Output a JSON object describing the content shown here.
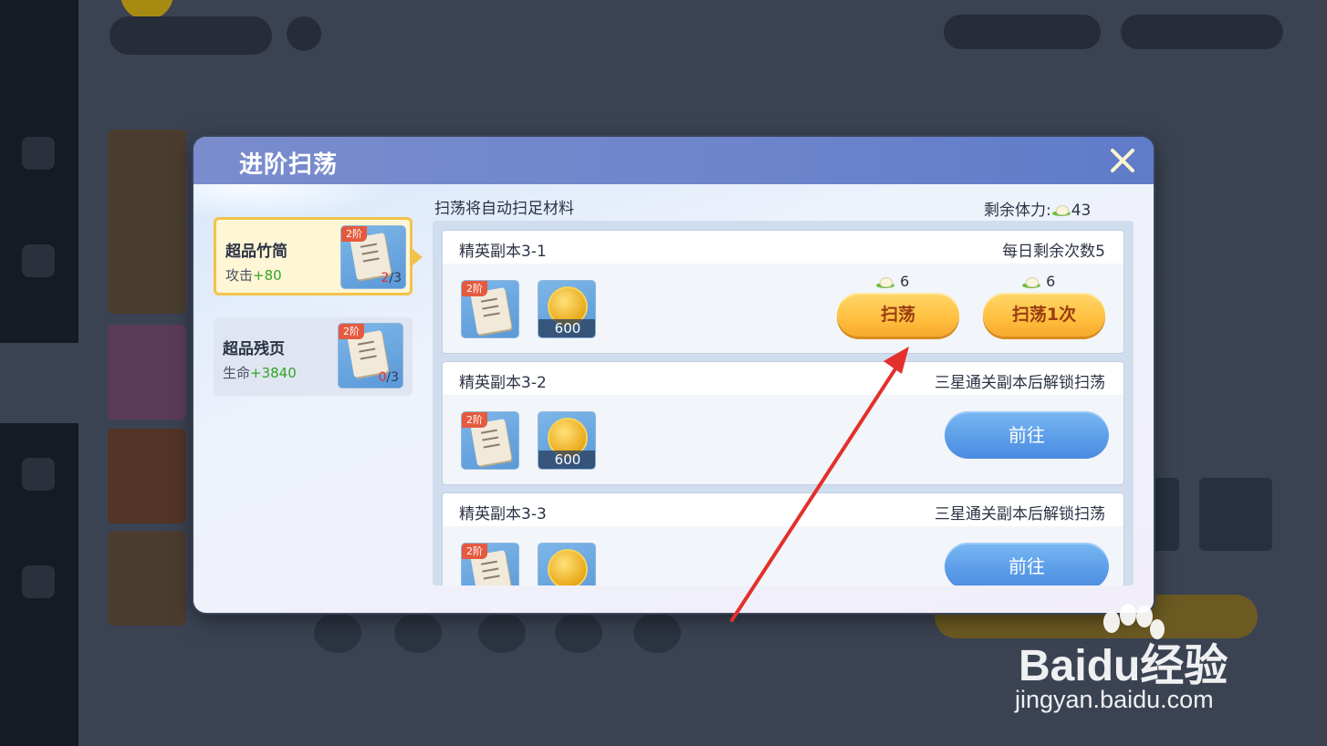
{
  "modal": {
    "title": "进阶扫荡",
    "hint": "扫荡将自动扫足材料",
    "stamina_label": "剩余体力:",
    "stamina_value": "43"
  },
  "materials": [
    {
      "name": "超品竹简",
      "stat_label": "攻击",
      "stat_value": "+80",
      "tier": "2阶",
      "owned": "2",
      "need": "/3"
    },
    {
      "name": "超品残页",
      "stat_label": "生命",
      "stat_value": "+3840",
      "tier": "2阶",
      "owned": "0",
      "need": "/3"
    }
  ],
  "stages": [
    {
      "name": "精英副本3-1",
      "info": "每日剩余次数5",
      "tier": "2阶",
      "coin_amount": "600",
      "sweep_label": "扫荡",
      "sweep_cost": "6",
      "sweep_once_label": "扫荡1次",
      "sweep_once_cost": "6"
    },
    {
      "name": "精英副本3-2",
      "info": "三星通关副本后解锁扫荡",
      "tier": "2阶",
      "coin_amount": "600",
      "goto_label": "前往"
    },
    {
      "name": "精英副本3-3",
      "info": "三星通关副本后解锁扫荡",
      "tier": "2阶",
      "goto_label": "前往"
    }
  ],
  "watermark": {
    "brand": "Bai",
    "brand2": "du",
    "cn": "经验",
    "url": "jingyan.baidu.com"
  },
  "colors": {
    "accent_orange": "#ffbf3f",
    "accent_blue": "#5a9ce8",
    "highlight_green": "#33a326",
    "annotation_red": "#e3302c"
  }
}
